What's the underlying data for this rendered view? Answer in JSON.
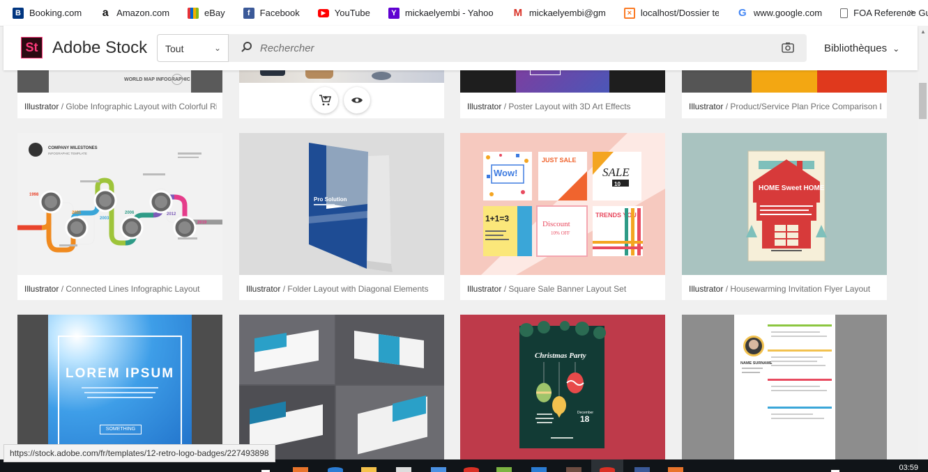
{
  "bookmarks": [
    {
      "label": "Booking.com",
      "icon": "booking-icon",
      "color": "#003580",
      "glyph": "B"
    },
    {
      "label": "Amazon.com",
      "icon": "amazon-icon",
      "color": "#ffffff",
      "glyph": "a"
    },
    {
      "label": "eBay",
      "icon": "ebay-icon",
      "color": "#e53238",
      "glyph": "e"
    },
    {
      "label": "Facebook",
      "icon": "facebook-icon",
      "color": "#3b5998",
      "glyph": "f"
    },
    {
      "label": "YouTube",
      "icon": "youtube-icon",
      "color": "#ff0000",
      "glyph": "▶"
    },
    {
      "label": "mickaelyembi - Yahoo",
      "icon": "yahoo-icon",
      "color": "#5f01d1",
      "glyph": "Y"
    },
    {
      "label": "mickaelyembi@gmail",
      "icon": "gmail-icon",
      "color": "#ffffff",
      "glyph": "M"
    },
    {
      "label": "localhost/Dossier test",
      "icon": "xampp-icon",
      "color": "#fb7a24",
      "glyph": "⊠"
    },
    {
      "label": "www.google.com",
      "icon": "google-icon",
      "color": "#ffffff",
      "glyph": "G"
    },
    {
      "label": "FOA Reference Guide",
      "icon": "document-icon",
      "color": "#5f6368",
      "glyph": "▤"
    }
  ],
  "header": {
    "logo": "St",
    "brand": "Adobe Stock",
    "scope": "Tout",
    "search_placeholder": "Rechercher",
    "libraries": "Bibliothèques"
  },
  "cards_row1": [
    {
      "type": "Illustrator",
      "title": " / Globe Infographic Layout with Colorful Rib..."
    },
    {
      "type": "",
      "title": ""
    },
    {
      "type": "Illustrator",
      "title": " / Poster Layout with 3D Art Effects"
    },
    {
      "type": "Illustrator",
      "title": " / Product/Service Plan Price Comparison La..."
    }
  ],
  "cards_row2": [
    {
      "type": "Illustrator",
      "title": " / Connected Lines Infographic Layout"
    },
    {
      "type": "Illustrator",
      "title": " / Folder Layout with Diagonal Elements"
    },
    {
      "type": "Illustrator",
      "title": " / Square Sale Banner Layout Set"
    },
    {
      "type": "Illustrator",
      "title": " / Housewarming Invitation Flyer Layout"
    }
  ],
  "thumb_text": {
    "world_map": "WORLD MAP INFOGRAPHIC",
    "milestones": "COMPANY MILESTONES",
    "milestones_sub": "INFOGRAPHIC TEMPLATE",
    "years": [
      "1998",
      "2001",
      "2003",
      "2006",
      "2012",
      "2019"
    ],
    "pro_solution": "Pro Solution",
    "wow": "Wow!",
    "just_sale": "JUST SALE",
    "sale": "SALE",
    "sale_pct": "10",
    "one_one": "1+1=3",
    "discount": "Discount",
    "discount_pct": "10% OFF",
    "trends": "TRENDS YOU",
    "home_sweet": "HOME Sweet HOME",
    "lorem": "LOREM IPSUM",
    "something": "SOMETHING",
    "christmas": "Christmas Party",
    "dec_day": "18",
    "december": "December",
    "name_surname": "NAME SURNAME"
  },
  "status_url": "https://stock.adobe.com/fr/templates/12-retro-logo-badges/227493898",
  "clock": "03:59",
  "colors": {
    "accent": "#ff3a7c",
    "logo_bg": "#2c0a12"
  }
}
